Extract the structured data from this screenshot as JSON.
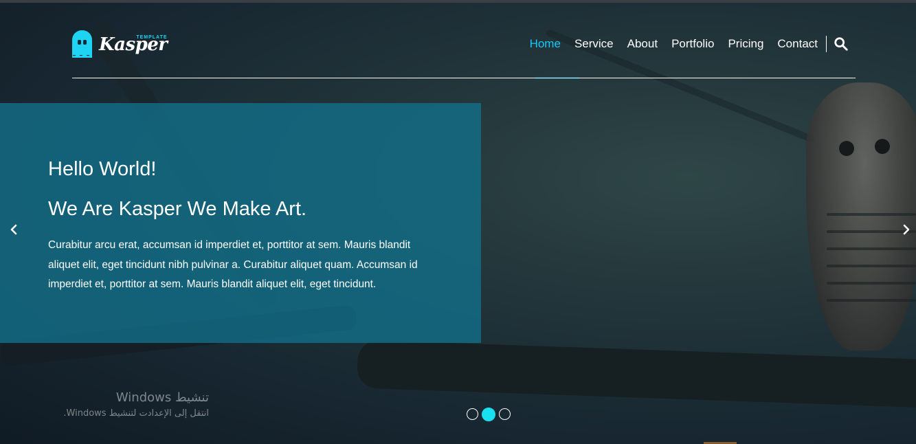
{
  "header": {
    "logo": {
      "text": "Kasper",
      "tagline": "TEMPLATE",
      "icon": "ghost-icon"
    },
    "nav": [
      {
        "label": "Home",
        "active": true
      },
      {
        "label": "Service",
        "active": false
      },
      {
        "label": "About",
        "active": false
      },
      {
        "label": "Portfolio",
        "active": false
      },
      {
        "label": "Pricing",
        "active": false
      },
      {
        "label": "Contact",
        "active": false
      }
    ],
    "search_icon": "search-icon"
  },
  "hero": {
    "greeting": "Hello World!",
    "headline": "We Are Kasper We Make Art.",
    "description": "Curabitur arcu erat, accumsan id imperdiet et, porttitor at sem. Mauris blandit aliquet elit, eget tincidunt nibh pulvinar a. Curabitur aliquet quam. Accumsan id imperdiet et, porttitor at sem. Mauris blandit aliquet elit, eget tincidunt.",
    "prev_icon": "chevron-left-icon",
    "next_icon": "chevron-right-icon",
    "slides": {
      "count": 3,
      "active_index": 1
    }
  },
  "os_watermark": {
    "title": "تنشيط Windows",
    "subtitle": "انتقل إلى الإعدادت لتنشيط Windows."
  },
  "colors": {
    "accent": "#19c8fa",
    "box": "#126e87",
    "bullet_active": "#19e0f0"
  }
}
